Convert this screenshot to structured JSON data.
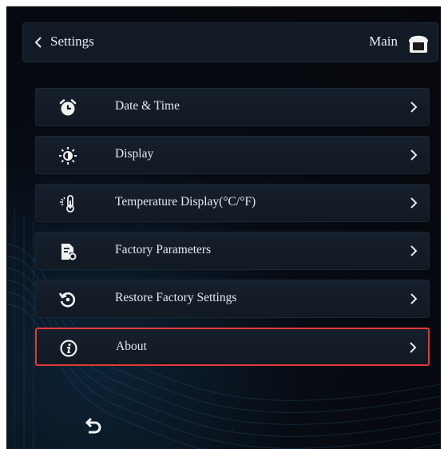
{
  "header": {
    "title": "Settings",
    "main_label": "Main",
    "back_icon": "chevron-left-icon",
    "home_icon": "home-icon"
  },
  "menu": {
    "items": [
      {
        "label": "Date & Time",
        "icon": "alarm-clock-icon",
        "selected": false
      },
      {
        "label": "Display",
        "icon": "brightness-icon",
        "selected": false
      },
      {
        "label": "Temperature Display(°C/°F)",
        "icon": "thermometer-icon",
        "selected": false
      },
      {
        "label": "Factory Parameters",
        "icon": "document-settings-icon",
        "selected": false
      },
      {
        "label": "Restore Factory Settings",
        "icon": "restore-icon",
        "selected": false
      },
      {
        "label": "About",
        "icon": "info-icon",
        "selected": true
      }
    ]
  },
  "footer": {
    "back_icon": "return-arrow-icon"
  },
  "colors": {
    "background": "#070b12",
    "item_background": "#141d28",
    "selected_border": "#e23a3a",
    "text": "#e6ebf1"
  }
}
